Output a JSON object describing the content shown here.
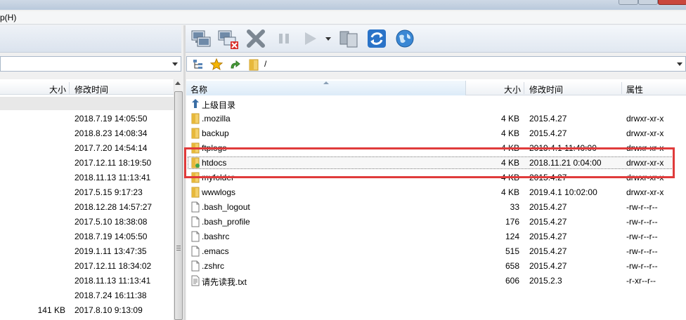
{
  "menu": {
    "help": "p(H)"
  },
  "toolbar": {
    "icons": [
      "connect-icon",
      "disconnect-icon",
      "cancel-icon",
      "pause-icon",
      "play-icon",
      "dropdown-icon",
      "sync-icon",
      "refresh-icon",
      "globe-icon"
    ]
  },
  "right_path": "/",
  "left_header": {
    "size": "大小",
    "modified": "修改时间"
  },
  "left_rows": [
    {
      "size": "",
      "modified": "2018.7.19 14:05:50"
    },
    {
      "size": "",
      "modified": "2018.8.23 14:08:34"
    },
    {
      "size": "",
      "modified": "2017.7.20 14:54:14"
    },
    {
      "size": "",
      "modified": "2017.12.11 18:19:50"
    },
    {
      "size": "",
      "modified": "2018.11.13 11:13:41"
    },
    {
      "size": "",
      "modified": "2017.5.15 9:17:23"
    },
    {
      "size": "",
      "modified": "2018.12.28 14:57:27"
    },
    {
      "size": "",
      "modified": "2017.5.10 18:38:08"
    },
    {
      "size": "",
      "modified": "2018.7.19 14:05:50"
    },
    {
      "size": "",
      "modified": "2019.1.11 13:47:35"
    },
    {
      "size": "",
      "modified": "2017.12.11 18:34:02"
    },
    {
      "size": "",
      "modified": "2018.11.13 11:13:41"
    },
    {
      "size": "",
      "modified": "2018.7.24 16:11:38"
    },
    {
      "size": "141 KB",
      "modified": "2017.8.10 9:13:09"
    }
  ],
  "right_header": {
    "name": "名称",
    "size": "大小",
    "modified": "修改时间",
    "attrs": "属性"
  },
  "right_rows": [
    {
      "name": "上级目录",
      "size": "",
      "modified": "",
      "attrs": "",
      "kind": "up"
    },
    {
      "name": ".mozilla",
      "size": "4 KB",
      "modified": "2015.4.27",
      "attrs": "drwxr-xr-x",
      "kind": "folder"
    },
    {
      "name": "backup",
      "size": "4 KB",
      "modified": "2015.4.27",
      "attrs": "drwxr-xr-x",
      "kind": "folder"
    },
    {
      "name": "ftplogs",
      "size": "4 KB",
      "modified": "2019.4.1 11:40:00",
      "attrs": "drwxr-xr-x",
      "kind": "folder"
    },
    {
      "name": "htdocs",
      "size": "4 KB",
      "modified": "2018.11.21 0:04:00",
      "attrs": "drwxr-xr-x",
      "kind": "folder-web"
    },
    {
      "name": "myfolder",
      "size": "4 KB",
      "modified": "2015.4.27",
      "attrs": "drwxr-xr-x",
      "kind": "folder"
    },
    {
      "name": "wwwlogs",
      "size": "4 KB",
      "modified": "2019.4.1 10:02:00",
      "attrs": "drwxr-xr-x",
      "kind": "folder"
    },
    {
      "name": ".bash_logout",
      "size": "33",
      "modified": "2015.4.27",
      "attrs": "-rw-r--r--",
      "kind": "file"
    },
    {
      "name": ".bash_profile",
      "size": "176",
      "modified": "2015.4.27",
      "attrs": "-rw-r--r--",
      "kind": "file"
    },
    {
      "name": ".bashrc",
      "size": "124",
      "modified": "2015.4.27",
      "attrs": "-rw-r--r--",
      "kind": "file"
    },
    {
      "name": ".emacs",
      "size": "515",
      "modified": "2015.4.27",
      "attrs": "-rw-r--r--",
      "kind": "file"
    },
    {
      "name": ".zshrc",
      "size": "658",
      "modified": "2015.4.27",
      "attrs": "-rw-r--r--",
      "kind": "file"
    },
    {
      "name": "请先读我.txt",
      "size": "606",
      "modified": "2015.2.3",
      "attrs": "-r-xr--r--",
      "kind": "text"
    }
  ],
  "colors": {
    "highlight": "#e03b3b",
    "folder": "#e7b83b",
    "accent": "#2a73c8"
  }
}
